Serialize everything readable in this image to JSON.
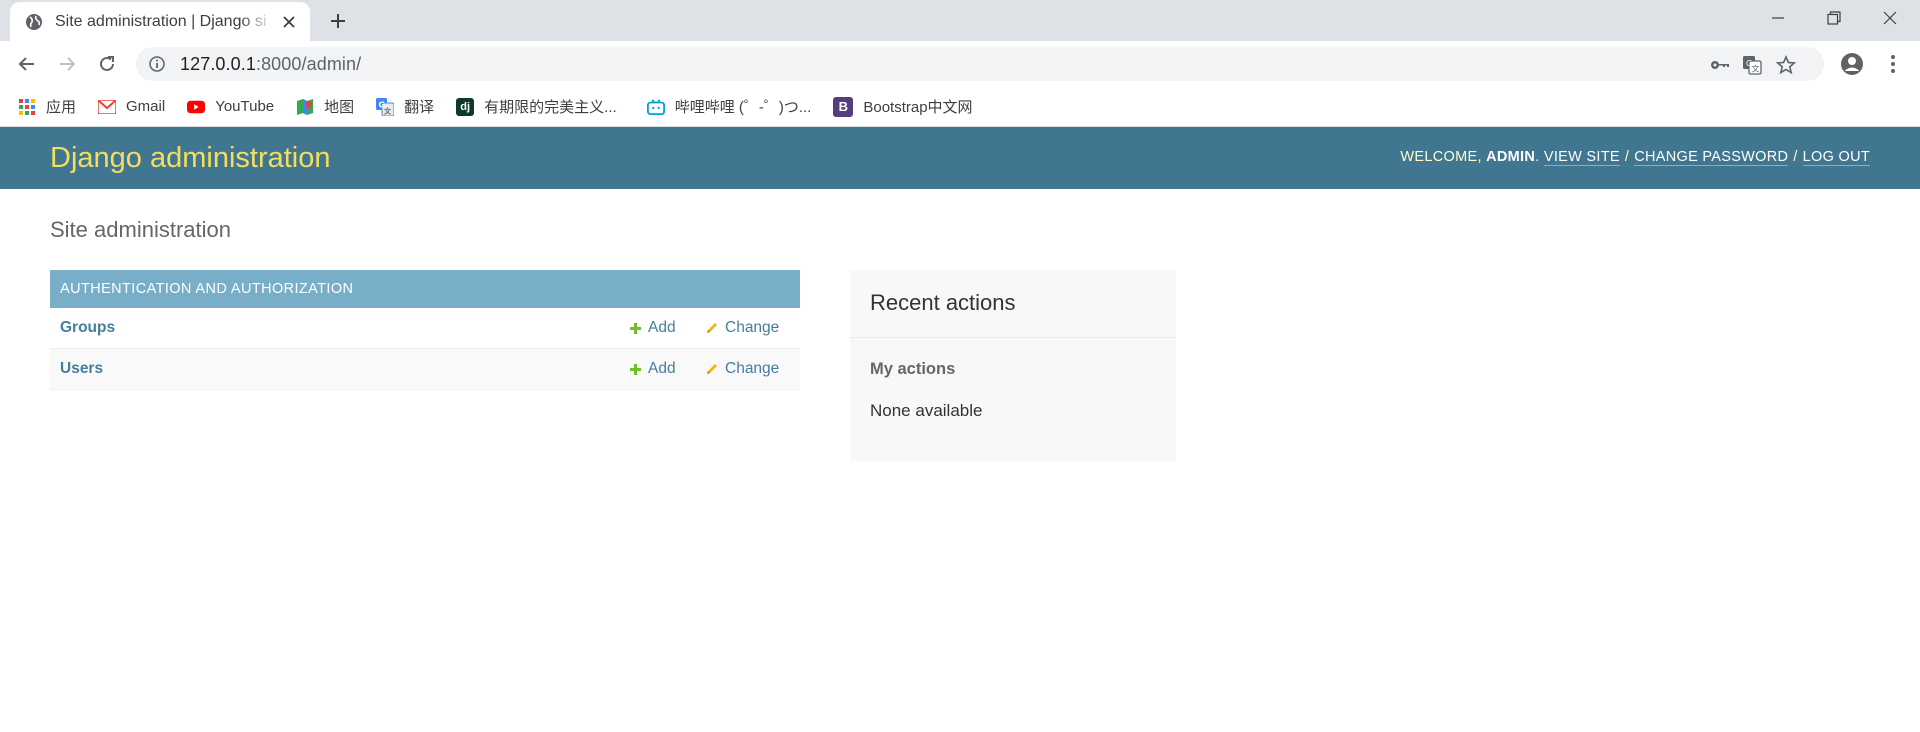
{
  "browser": {
    "tab_title": "Site administration | Django si",
    "url_host": "127.0.0.1",
    "url_rest": ":8000/admin/",
    "bookmarks": [
      {
        "label": "应用",
        "icon": "apps-grid-icon"
      },
      {
        "label": "Gmail",
        "icon": "gmail-icon"
      },
      {
        "label": "YouTube",
        "icon": "youtube-icon"
      },
      {
        "label": "地图",
        "icon": "maps-icon"
      },
      {
        "label": "翻译",
        "icon": "translate-icon"
      },
      {
        "label": "有期限的完美主义...",
        "icon": "dj-icon",
        "icon_text": "dj"
      },
      {
        "label": "哔哩哔哩 (゜-゜)つ...",
        "icon": "bilibili-icon"
      },
      {
        "label": "Bootstrap中文网",
        "icon": "bootstrap-icon",
        "icon_text": "B"
      }
    ]
  },
  "header": {
    "branding": "Django administration",
    "welcome": "WELCOME,",
    "username": "ADMIN",
    "username_suffix": ".",
    "view_site": "VIEW SITE",
    "change_password": "CHANGE PASSWORD",
    "log_out": "LOG OUT",
    "separator": "/"
  },
  "main": {
    "title": "Site administration",
    "module": {
      "caption": "Authentication and Authorization",
      "rows": [
        {
          "name": "Groups",
          "add": "Add",
          "change": "Change"
        },
        {
          "name": "Users",
          "add": "Add",
          "change": "Change"
        }
      ]
    }
  },
  "recent": {
    "title": "Recent actions",
    "subtitle": "My actions",
    "empty": "None available"
  },
  "colors": {
    "header_bg": "#417690",
    "branding": "#f5dd5d",
    "caption_bg": "#79aec8",
    "link": "#447e9b",
    "add_icon": "#70bf2b",
    "change_icon": "#efb80b"
  }
}
